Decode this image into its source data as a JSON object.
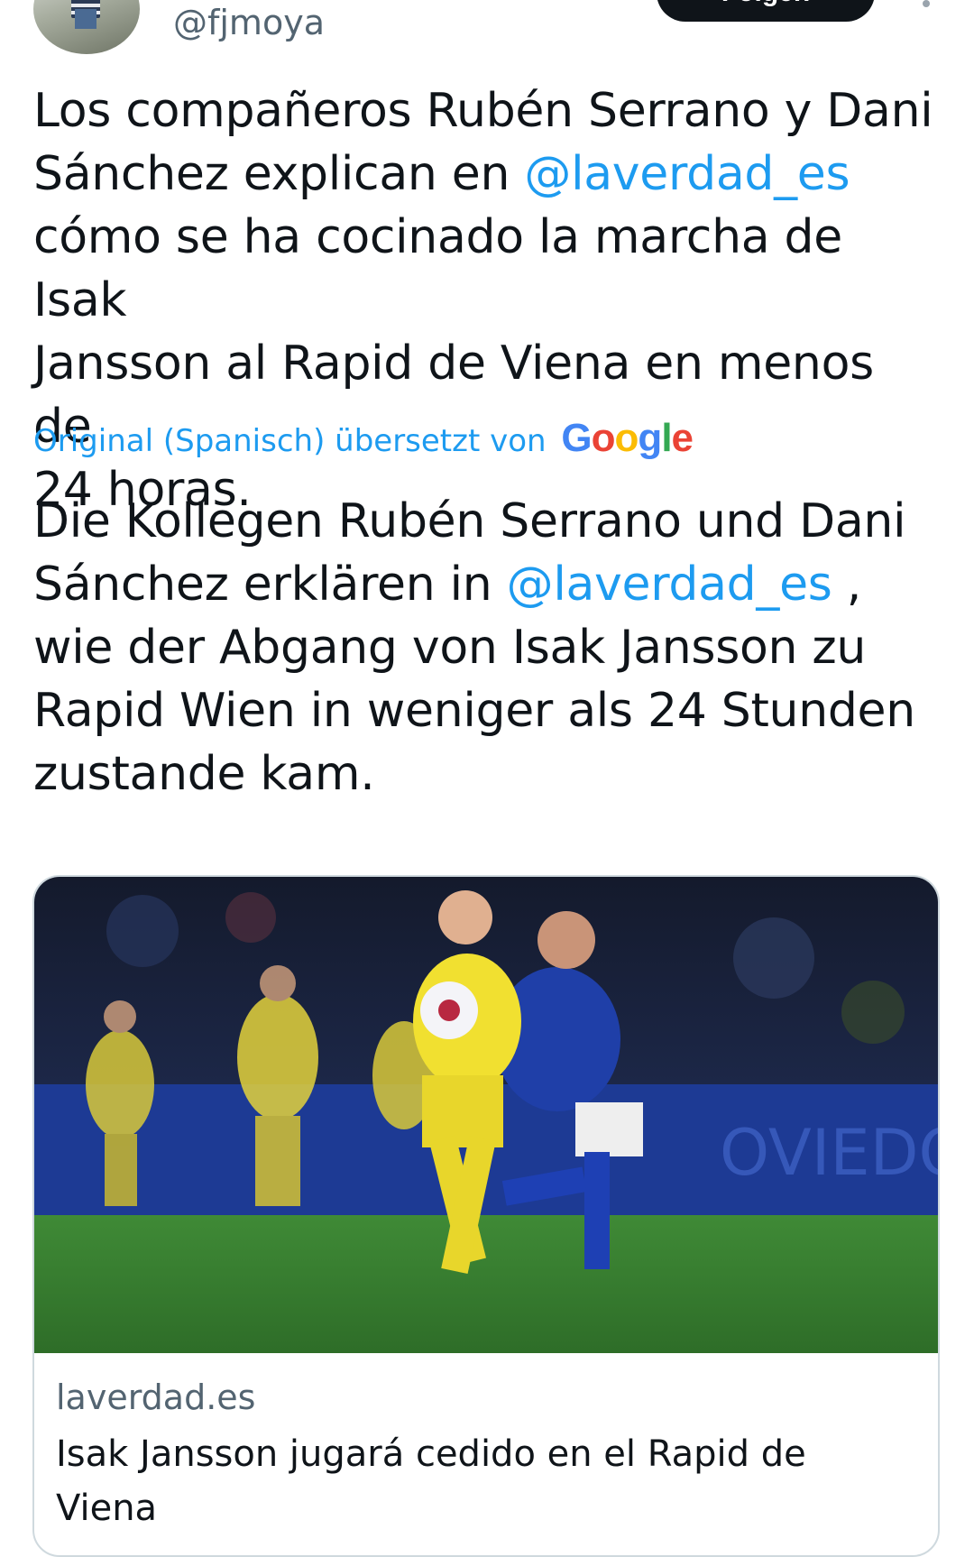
{
  "tweet": {
    "handle": "@fjmoya",
    "follow_label": "Folgen",
    "original_text": {
      "part1": "Los compañeros Rubén Serrano y Dani\nSánchez explican en ",
      "mention": "@laverdad_es",
      "part2": "\ncómo se ha cocinado la marcha de Isak\nJansson al Rapid de Viena en menos de\n24 horas."
    },
    "translation": {
      "label": "Original (Spanisch) übersetzt von",
      "provider": "Google"
    },
    "translated_text": {
      "part1": "Die Kollegen Rubén Serrano und Dani\nSánchez erklären in ",
      "mention": "@laverdad_es",
      "part2": " ,\nwie der Abgang von Isak Jansson zu\nRapid Wien in weniger als 24 Stunden\nzustande kam."
    }
  },
  "link_card": {
    "domain": "laverdad.es",
    "title": "Isak Jansson jugará cedido en el Rapid de\nViena",
    "image_icon": "football-match-photo"
  },
  "colors": {
    "link": "#1d9bf0",
    "text": "#0f1419",
    "secondary": "#536471",
    "border": "#cfd9de",
    "follow_button": "#0f1419"
  }
}
